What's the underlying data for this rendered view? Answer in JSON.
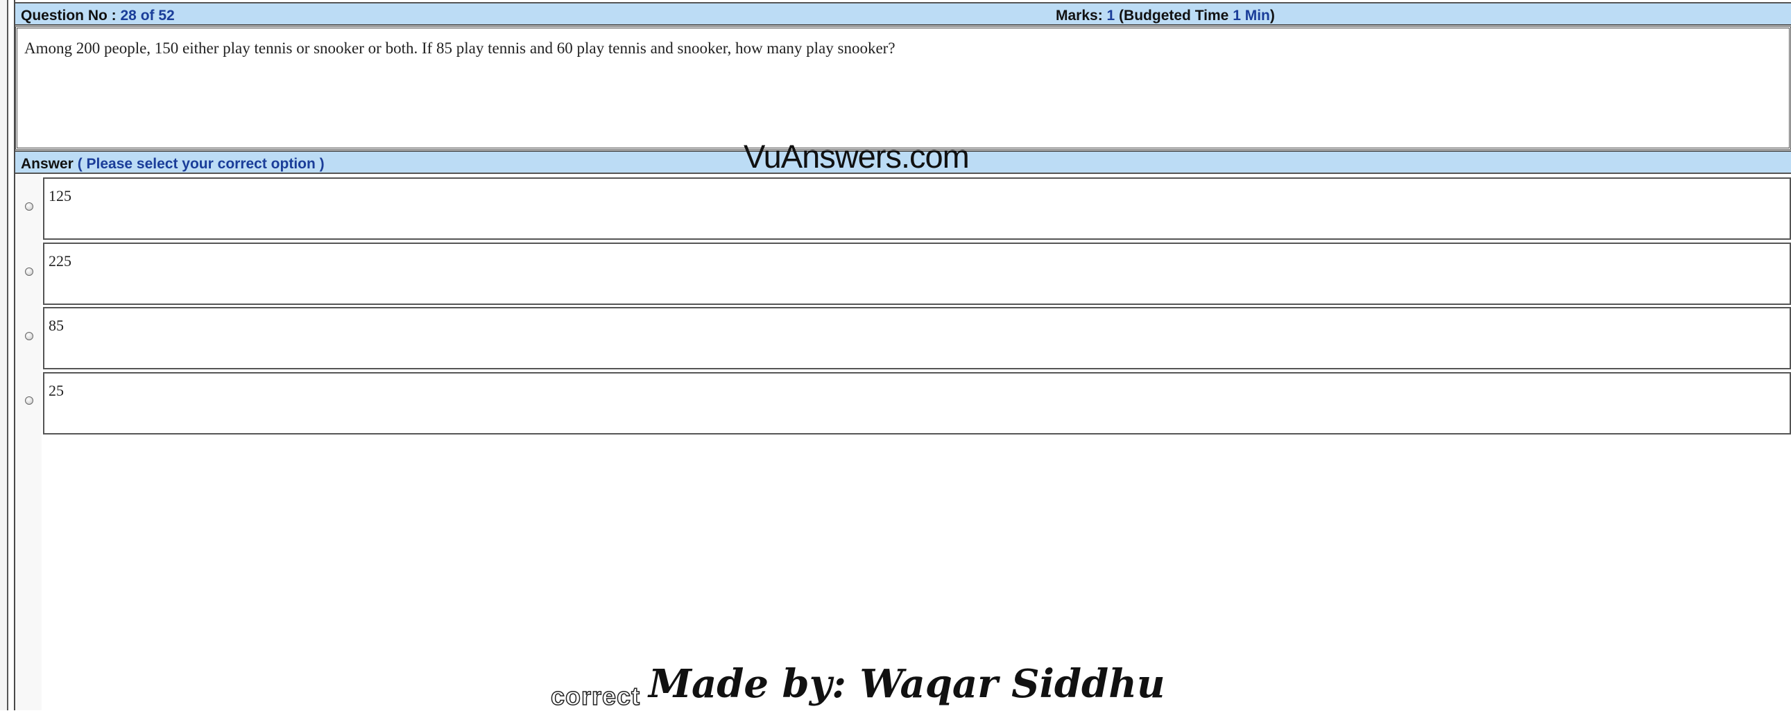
{
  "question_header": {
    "label": "Question No : ",
    "current": "28 of 52",
    "marks_label": "Marks: ",
    "marks": "1",
    "budget_open": " (Budgeted Time ",
    "budget_value": "1 Min",
    "budget_close": ")"
  },
  "question": {
    "text": "Among 200 people, 150 either play tennis or snooker or both. If 85 play tennis and 60 play tennis and snooker, how many play snooker?"
  },
  "answer_header": {
    "label": "Answer ",
    "hint": "( Please select your correct option )"
  },
  "options": [
    {
      "text": "125"
    },
    {
      "text": "225"
    },
    {
      "text": "85"
    },
    {
      "text": "25"
    }
  ],
  "watermarks": {
    "site": "VuAnswers.com",
    "author": "Made by: Waqar Siddhu",
    "marker": "correct"
  }
}
